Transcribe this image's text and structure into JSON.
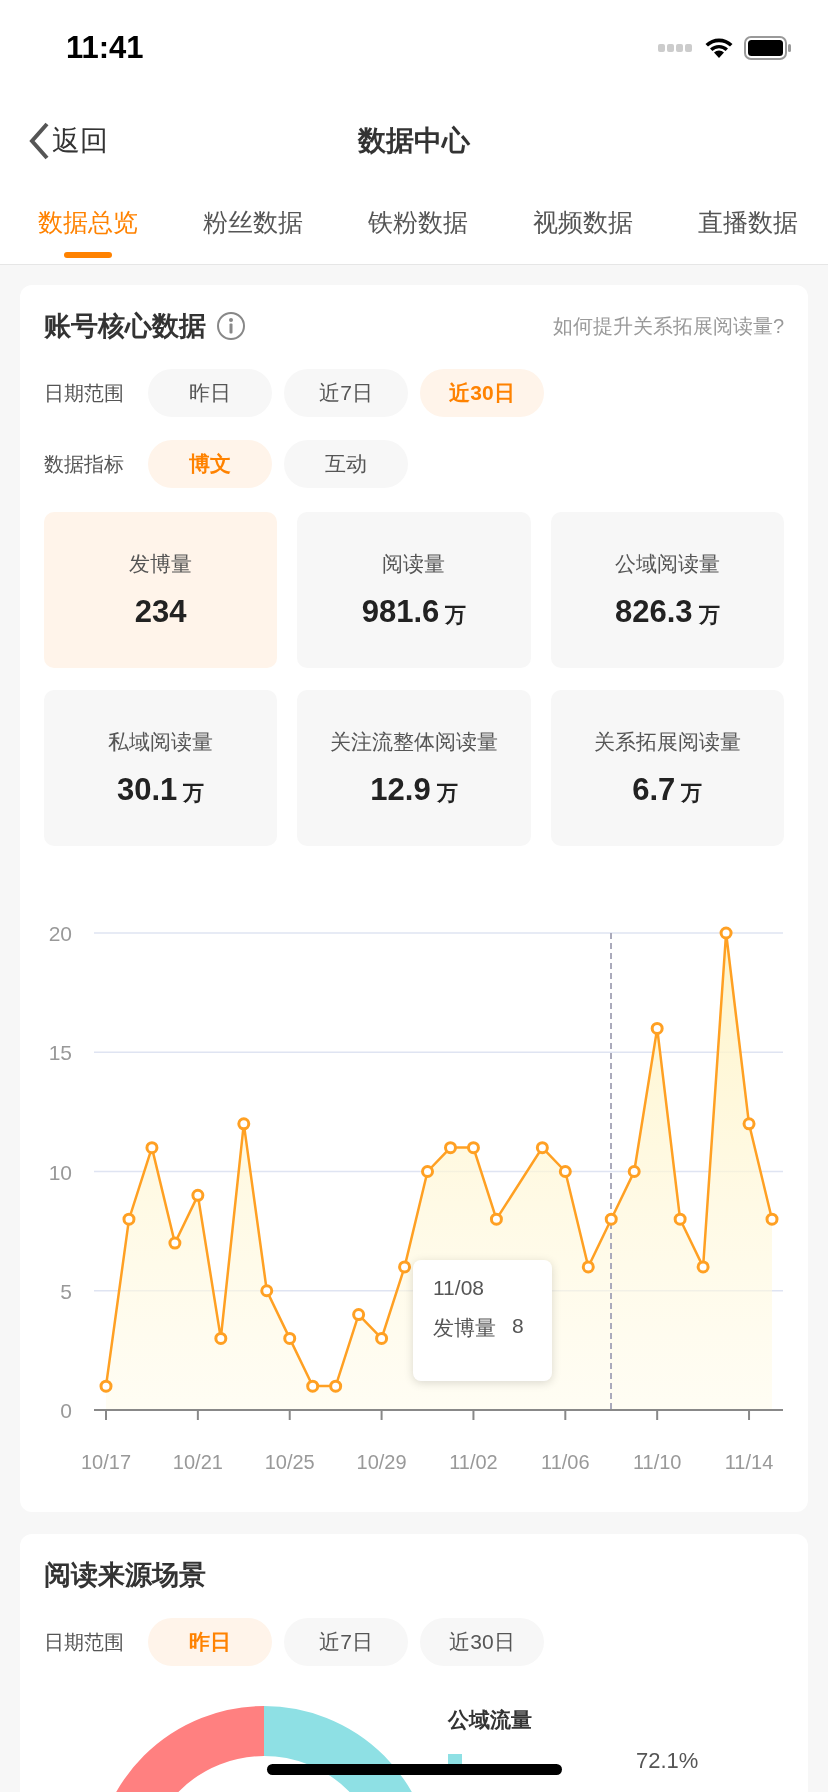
{
  "status_bar": {
    "time": "11:41"
  },
  "nav": {
    "back": "返回",
    "title": "数据中心"
  },
  "tabs": [
    {
      "label": "数据总览",
      "selected": true
    },
    {
      "label": "粉丝数据",
      "selected": false
    },
    {
      "label": "铁粉数据",
      "selected": false
    },
    {
      "label": "视频数据",
      "selected": false
    },
    {
      "label": "直播数据",
      "selected": false
    }
  ],
  "core_card": {
    "title": "账号核心数据",
    "help_link": "如何提升关系拓展阅读量?",
    "filters": [
      {
        "label": "日期范围",
        "options": [
          {
            "label": "昨日",
            "selected": false
          },
          {
            "label": "近7日",
            "selected": false
          },
          {
            "label": "近30日",
            "selected": true
          }
        ]
      },
      {
        "label": "数据指标",
        "options": [
          {
            "label": "博文",
            "selected": true
          },
          {
            "label": "互动",
            "selected": false
          }
        ]
      }
    ],
    "stats": [
      {
        "label": "发博量",
        "value": "234",
        "selected": true
      },
      {
        "label": "阅读量",
        "value": "981.6",
        "unit": "万",
        "selected": false
      },
      {
        "label": "公域阅读量",
        "value": "826.3",
        "unit": "万",
        "selected": false
      },
      {
        "label": "私域阅读量",
        "value": "30.1",
        "unit": "万",
        "selected": false
      },
      {
        "label": "关注流整体阅读量",
        "value": "12.9",
        "unit": "万",
        "selected": false
      },
      {
        "label": "关系拓展阅读量",
        "value": "6.7",
        "unit": "万",
        "selected": false
      }
    ],
    "chart": {
      "chart_data": {
        "type": "area",
        "categories": [
          "10/17",
          null,
          null,
          null,
          "10/21",
          null,
          null,
          null,
          "10/25",
          null,
          null,
          null,
          "10/29",
          null,
          null,
          null,
          "11/02",
          null,
          null,
          null,
          "11/06",
          null,
          null,
          null,
          "11/10",
          null,
          null,
          null,
          "11/14",
          null
        ],
        "series": [
          {
            "name": "发博量",
            "color": "#ffa023",
            "values": [
              1,
              8,
              11,
              7,
              9,
              3,
              12,
              5,
              3,
              1,
              1,
              4,
              3,
              6,
              10,
              11,
              11,
              8,
              null,
              11,
              10,
              6,
              8,
              10,
              16,
              8,
              6,
              20,
              12,
              8
            ]
          }
        ],
        "grid": true,
        "ylim": [
          0,
          20
        ],
        "yticks": [
          0,
          5,
          10,
          15,
          20
        ]
      },
      "tooltip": {
        "date": "11/08",
        "value": "8"
      }
    }
  },
  "source_card": {
    "title": "阅读来源场景",
    "filters": [
      {
        "label": "日期范围",
        "options": [
          {
            "label": "昨日",
            "selected": true
          },
          {
            "label": "近7日",
            "selected": false
          },
          {
            "label": "近30日",
            "selected": false
          }
        ]
      }
    ],
    "legend": {
      "title": "公域流量",
      "items": [
        {
          "value": "72.1%",
          "color": "#8ee0e4"
        }
      ]
    }
  }
}
